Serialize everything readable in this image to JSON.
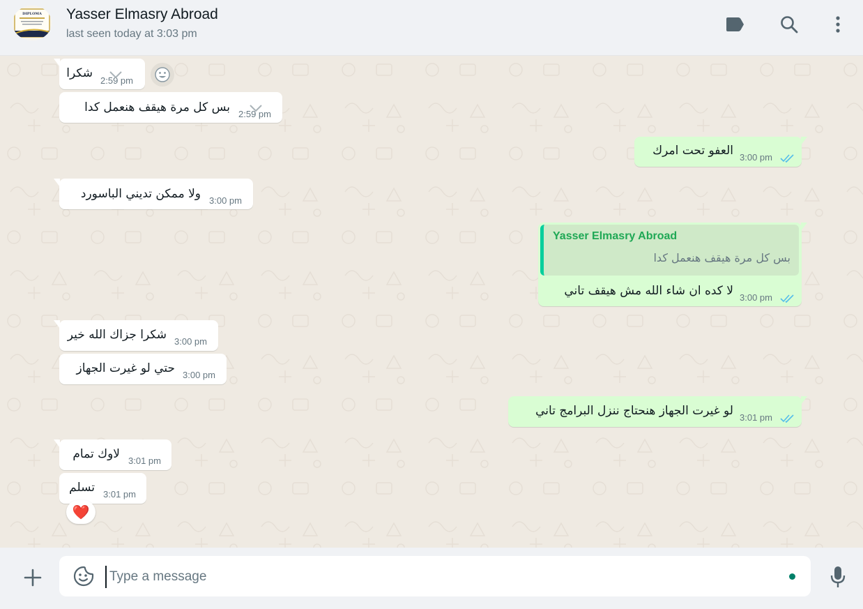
{
  "header": {
    "contact_name": "Yasser Elmasry Abroad",
    "last_seen": "last seen today at 3:03 pm",
    "avatar_text": "DIPLOMA",
    "icons": [
      "label-icon",
      "search-icon",
      "menu-icon"
    ]
  },
  "messages": [
    {
      "dir": "in",
      "text": "شكرا",
      "time": "2:59 pm"
    },
    {
      "dir": "in",
      "text": "بس كل مرة هيقف هنعمل كدا",
      "time": "2:59 pm"
    },
    {
      "dir": "out",
      "text": "العفو تحت امرك",
      "time": "3:00 pm"
    },
    {
      "dir": "in",
      "text": "ولا ممكن تديني الباسورد",
      "time": "3:00 pm"
    },
    {
      "dir": "out",
      "quote_author": "Yasser Elmasry Abroad",
      "quote_text": "بس كل مرة هيقف هنعمل كدا",
      "text": "لا كده ان شاء الله مش هيقف تاني",
      "time": "3:00 pm"
    },
    {
      "dir": "in",
      "text": "شكرا جزاك الله خير",
      "time": "3:00 pm"
    },
    {
      "dir": "in",
      "text": "حتي لو غيرت الجهاز",
      "time": "3:00 pm"
    },
    {
      "dir": "out",
      "text": "لو غيرت الجهاز هنحتاج ننزل البرامج تاني",
      "time": "3:01 pm"
    },
    {
      "dir": "in",
      "text": "لاوك تمام",
      "time": "3:01 pm"
    },
    {
      "dir": "in",
      "text": "تسلم",
      "time": "3:01 pm",
      "reaction": "❤️"
    }
  ],
  "composer": {
    "placeholder": "Type a message"
  },
  "colors": {
    "chat_bg": "#efeae2",
    "incoming": "#ffffff",
    "outgoing": "#d9fdd3",
    "read_ticks": "#53bdeb",
    "quote_bar": "#06cf9c",
    "accent": "#008069"
  }
}
